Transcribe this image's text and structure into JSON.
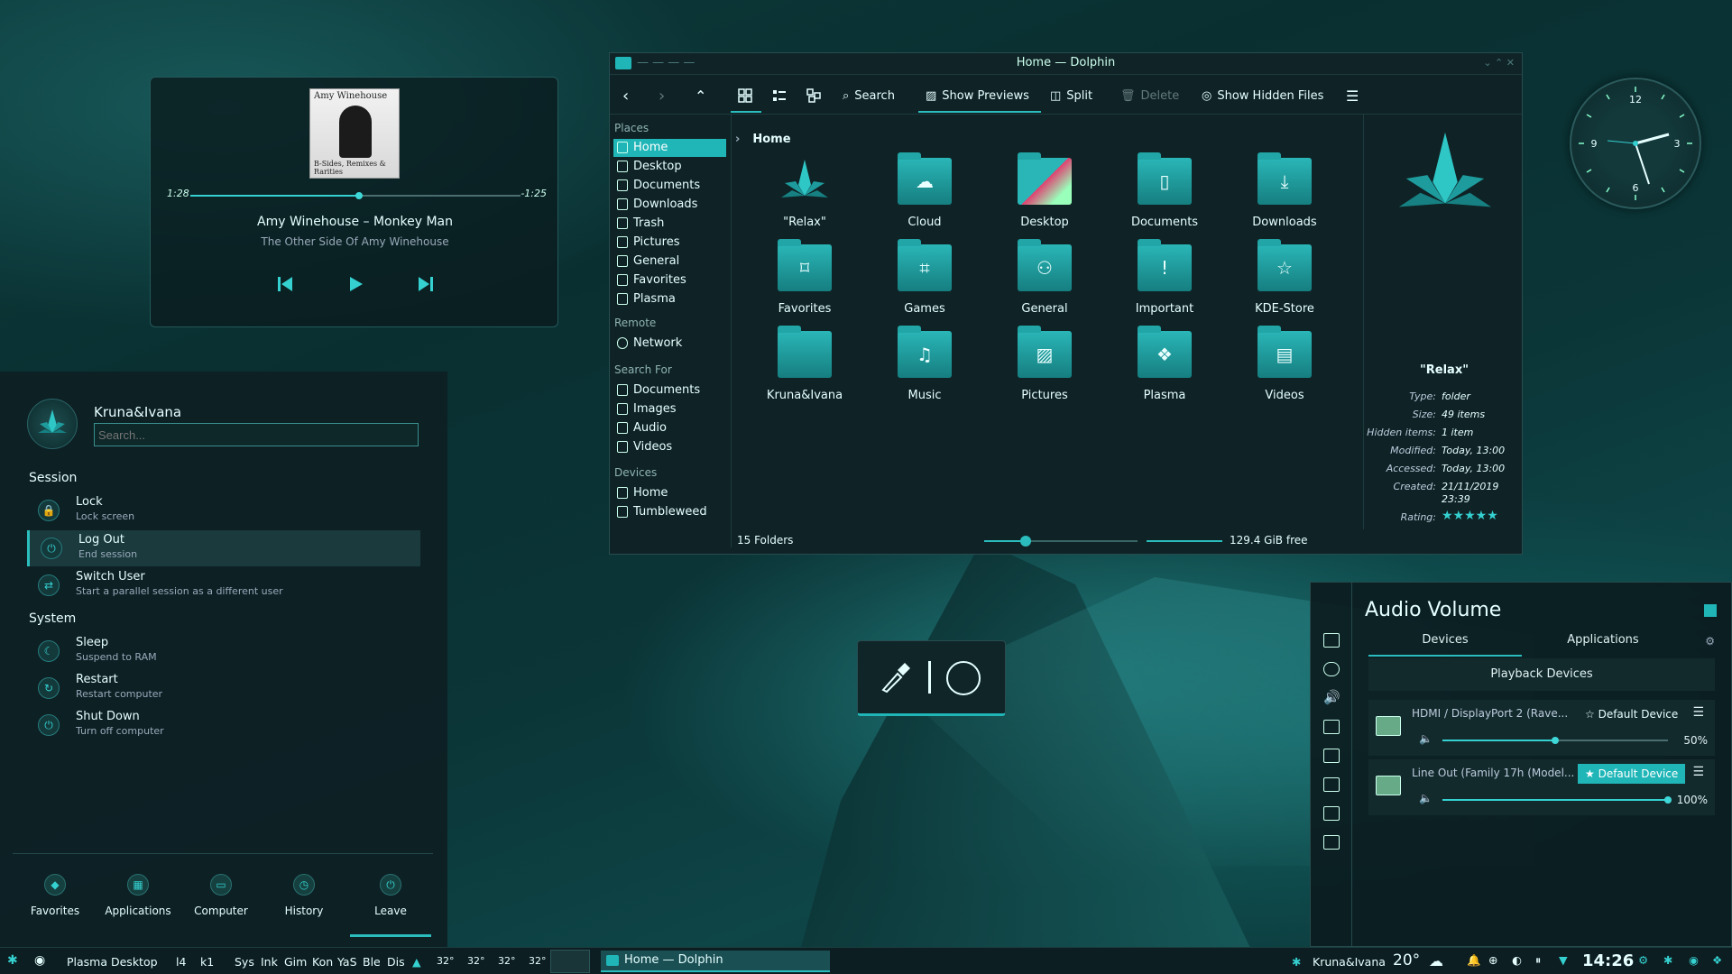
{
  "media": {
    "elapsed": "1:28",
    "remaining": "-1:25",
    "progress": 0.51,
    "title": "Amy Winehouse – Monkey Man",
    "album": "The Other Side Of Amy Winehouse",
    "cover_top": "Amy Winehouse",
    "cover_bottom": "B-Sides, Remixes & Rarities"
  },
  "launcher": {
    "user": "Kruna&Ivana",
    "search_placeholder": "Search...",
    "session_header": "Session",
    "system_header": "System",
    "session": [
      {
        "title": "Lock",
        "sub": "Lock screen"
      },
      {
        "title": "Log Out",
        "sub": "End session"
      },
      {
        "title": "Switch User",
        "sub": "Start a parallel session as a different user"
      }
    ],
    "system": [
      {
        "title": "Sleep",
        "sub": "Suspend to RAM"
      },
      {
        "title": "Restart",
        "sub": "Restart computer"
      },
      {
        "title": "Shut Down",
        "sub": "Turn off computer"
      }
    ],
    "tabs": [
      "Favorites",
      "Applications",
      "Computer",
      "History",
      "Leave"
    ]
  },
  "dolphin": {
    "title": "Home — Dolphin",
    "toolbar": {
      "search": "Search",
      "previews": "Show Previews",
      "split": "Split",
      "delete": "Delete",
      "hidden": "Show Hidden Files"
    },
    "places_header": "Places",
    "places": [
      "Home",
      "Desktop",
      "Documents",
      "Downloads",
      "Trash",
      "Pictures",
      "General",
      "Favorites",
      "Plasma"
    ],
    "remote_header": "Remote",
    "remote": [
      "Network"
    ],
    "searchfor_header": "Search For",
    "searchfor": [
      "Documents",
      "Images",
      "Audio",
      "Videos"
    ],
    "devices_header": "Devices",
    "devices": [
      "Home",
      "Tumbleweed"
    ],
    "breadcrumb": "Home",
    "folders": [
      {
        "name": "\"Relax\"",
        "icon": "leaf-icon"
      },
      {
        "name": "Cloud",
        "icon": "cloud-icon"
      },
      {
        "name": "Desktop",
        "icon": "desktop-icon"
      },
      {
        "name": "Documents",
        "icon": "document-icon"
      },
      {
        "name": "Downloads",
        "icon": "download-icon"
      },
      {
        "name": "Favorites",
        "icon": "bookmark-icon"
      },
      {
        "name": "Games",
        "icon": "gamepad-icon"
      },
      {
        "name": "General",
        "icon": "people-icon"
      },
      {
        "name": "Important",
        "icon": "exclamation-icon"
      },
      {
        "name": "KDE-Store",
        "icon": "star-icon"
      },
      {
        "name": "Kruna&Ivana",
        "icon": "folder-icon"
      },
      {
        "name": "Music",
        "icon": "music-icon"
      },
      {
        "name": "Pictures",
        "icon": "picture-icon"
      },
      {
        "name": "Plasma",
        "icon": "plasma-icon"
      },
      {
        "name": "Videos",
        "icon": "film-icon"
      }
    ],
    "status_count": "15 Folders",
    "free_space": "129.4 GiB free",
    "info": {
      "name": "\"Relax\"",
      "rows": [
        {
          "k": "Type:",
          "v": "folder"
        },
        {
          "k": "Size:",
          "v": "49 items"
        },
        {
          "k": "Hidden items:",
          "v": "1 item"
        },
        {
          "k": "Modified:",
          "v": "Today, 13:00"
        },
        {
          "k": "Accessed:",
          "v": "Today, 13:00"
        },
        {
          "k": "Created:",
          "v": "21/11/2019"
        },
        {
          "k": "",
          "v": "23:39"
        },
        {
          "k": "Rating:",
          "v": "★★★★★"
        }
      ]
    }
  },
  "clock": {
    "n12": "12",
    "n3": "3",
    "n6": "6",
    "n9": "9"
  },
  "audio": {
    "title": "Audio Volume",
    "tab_devices": "Devices",
    "tab_apps": "Applications",
    "section": "Playback Devices",
    "devices": [
      {
        "name": "HDMI / DisplayPort 2 (Rave...",
        "button": "Default Device",
        "volume": "50%",
        "level": 0.5
      },
      {
        "name": "Line Out (Family 17h (Model...",
        "button": "Default Device",
        "volume": "100%",
        "level": 1.0
      }
    ]
  },
  "taskbar": {
    "activity": "Plasma Desktop",
    "items": [
      "l4",
      "k1",
      "Sys",
      "Ink",
      "Gim",
      "Kon",
      "YaS",
      "Ble",
      "Dis"
    ],
    "temps": [
      "32°",
      "32°",
      "32°",
      "32°"
    ],
    "task": "Home — Dolphin",
    "user": "Kruna&Ivana",
    "weather": "20°",
    "time": "14:26"
  },
  "colors": {
    "accent": "#20b6b8",
    "bg": "#0b3032"
  }
}
